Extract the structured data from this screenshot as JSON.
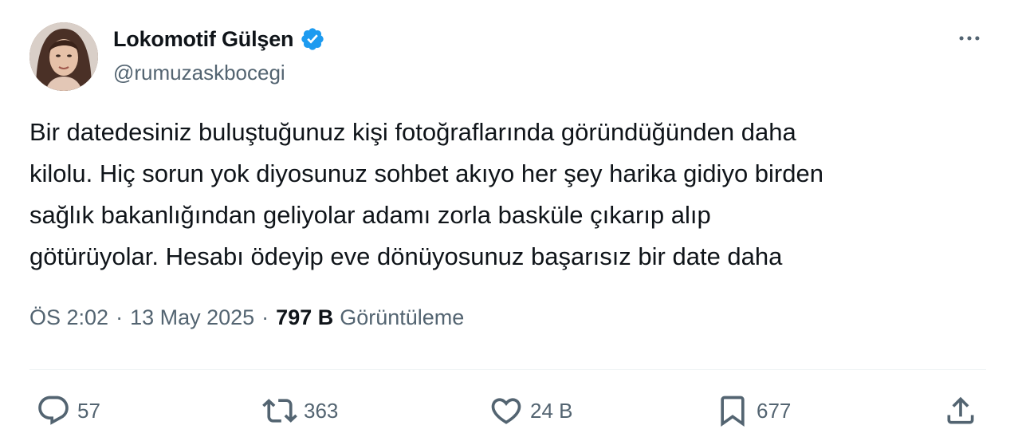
{
  "author": {
    "display_name": "Lokomotif Gülşen",
    "handle": "@rumuzaskbocegi",
    "verified": true,
    "verified_color": "#1d9bf0"
  },
  "tweet": {
    "text": "Bir datedesiniz buluştuğunuz kişi fotoğraflarında göründüğünden daha\nkilolu. Hiç sorun yok diyosunuz sohbet akıyo her şey harika gidiyo birden\nsağlık bakanlığından geliyolar adamı zorla basküle çıkarıp alıp\ngötürüyolar. Hesabı ödeyip eve dönüyosunuz başarısız bir date daha"
  },
  "meta": {
    "time": "ÖS 2:02",
    "separator": "·",
    "date": "13 May 2025",
    "views_count": "797 B",
    "views_label": "Görüntüleme"
  },
  "actions": {
    "replies": "57",
    "retweets": "363",
    "likes": "24 B",
    "bookmarks": "677"
  },
  "icons": {
    "more": "more-horizontal-icon",
    "reply": "reply-icon",
    "retweet": "retweet-icon",
    "like": "heart-icon",
    "bookmark": "bookmark-icon",
    "share": "share-icon",
    "verified": "verified-badge-icon"
  },
  "colors": {
    "text": "#0f1419",
    "secondary": "#536471",
    "divider": "#eff3f4"
  }
}
